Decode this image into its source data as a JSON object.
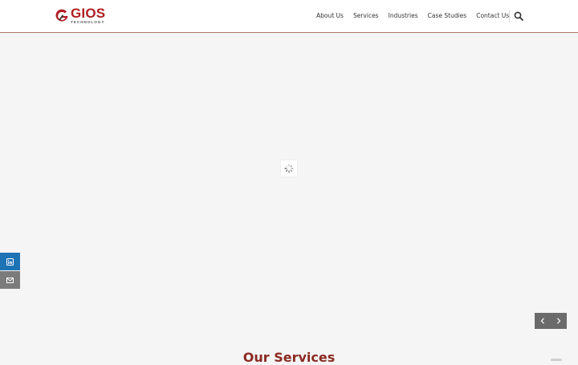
{
  "logo": {
    "word": "GIOS",
    "sub": "TECHNOLOGY"
  },
  "nav": {
    "items": [
      {
        "label": "About Us"
      },
      {
        "label": "Services"
      },
      {
        "label": "Industries"
      },
      {
        "label": "Case Studies"
      },
      {
        "label": "Contact Us"
      }
    ],
    "search_icon": "search-icon"
  },
  "hero": {
    "loader_icon": "spinner-icon"
  },
  "social": {
    "linkedin_icon": "linkedin-icon",
    "mail_icon": "mail-icon",
    "colors": {
      "linkedin": "#1e73b5",
      "mail": "#7b7b7b"
    }
  },
  "slider": {
    "prev_icon": "chevron-left-icon",
    "next_icon": "chevron-right-icon"
  },
  "services": {
    "title": "Our Services"
  },
  "colors": {
    "brand": "#b01e23",
    "header_border": "#b5756f",
    "background": "#f5f5f5"
  }
}
